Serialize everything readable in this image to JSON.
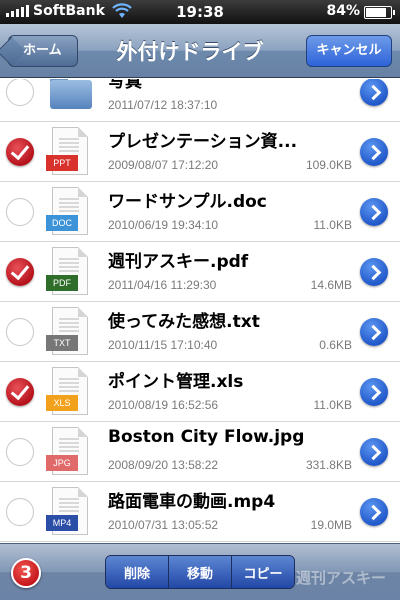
{
  "status_bar": {
    "carrier": "SoftBank",
    "time": "19:38",
    "battery_percent": "84%",
    "battery_level": 0.84
  },
  "navbar": {
    "back_label": "ホーム",
    "title": "外付けドライブ",
    "cancel_label": "キャンセル"
  },
  "files": [
    {
      "name": "写真",
      "date": "2011/07/12 18:37:10",
      "size": "",
      "type": "folder",
      "tag": "",
      "selected": false
    },
    {
      "name": "プレゼンテーション資...",
      "date": "2009/08/07 17:12:20",
      "size": "109.0KB",
      "type": "file",
      "tag": "PPT",
      "tag_color": "#d9312b",
      "selected": true
    },
    {
      "name": "ワードサンプル.doc",
      "date": "2010/06/19 19:34:10",
      "size": "11.0KB",
      "type": "file",
      "tag": "DOC",
      "tag_color": "#3c93d8",
      "selected": false
    },
    {
      "name": "週刊アスキー.pdf",
      "date": "2011/04/16 11:29:30",
      "size": "14.6MB",
      "type": "file",
      "tag": "PDF",
      "tag_color": "#2f6e2a",
      "selected": true
    },
    {
      "name": "使ってみた感想.txt",
      "date": "2010/11/15 17:10:40",
      "size": "0.6KB",
      "type": "file",
      "tag": "TXT",
      "tag_color": "#777777",
      "selected": false
    },
    {
      "name": "ポイント管理.xls",
      "date": "2010/08/19 16:52:56",
      "size": "11.0KB",
      "type": "file",
      "tag": "XLS",
      "tag_color": "#f2a11c",
      "selected": true
    },
    {
      "name": "Boston City Flow.jpg",
      "date": "2008/09/20 13:58:22",
      "size": "331.8KB",
      "type": "file",
      "tag": "JPG",
      "tag_color": "#e06a6a",
      "selected": false
    },
    {
      "name": "路面電車の動画.mp4",
      "date": "2010/07/31 13:05:52",
      "size": "19.0MB",
      "type": "file",
      "tag": "MP4",
      "tag_color": "#2b4fa6",
      "selected": false
    }
  ],
  "toolbar": {
    "selected_count": "3",
    "delete_label": "削除",
    "move_label": "移動",
    "copy_label": "コピー",
    "watermark": "週刊アスキー"
  }
}
